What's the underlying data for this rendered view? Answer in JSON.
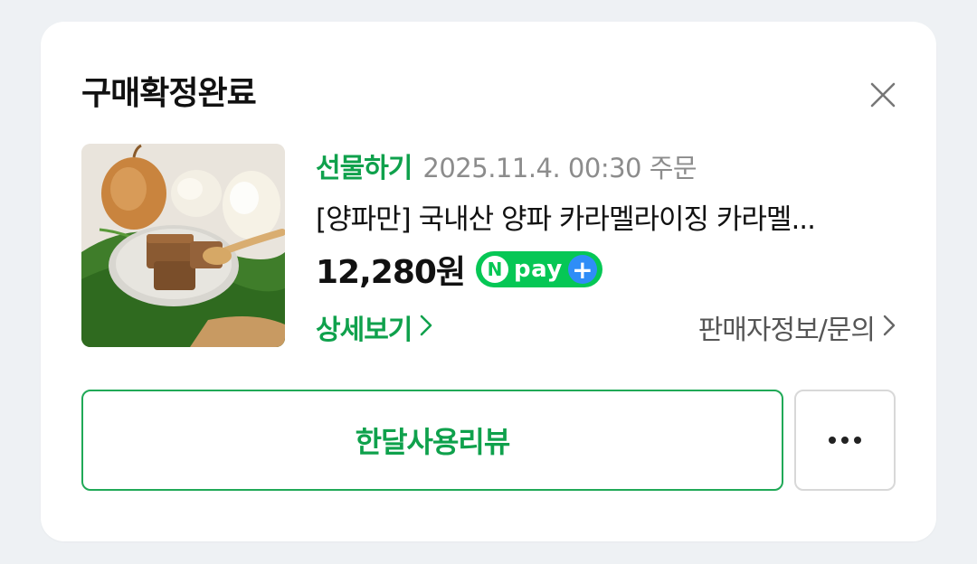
{
  "header": {
    "title": "구매확정완료",
    "close_icon": "close-icon"
  },
  "order": {
    "type_label": "선물하기",
    "order_date": "2025.11.4. 00:30 주문",
    "product_name": "[양파만] 국내산 양파 카라멜라이징 카라멜...",
    "price": "12,280원",
    "pay_badge": {
      "n": "N",
      "word": "pay",
      "plus": "+"
    },
    "detail_link": "상세보기",
    "seller_link": "판매자정보/문의"
  },
  "actions": {
    "review_label": "한달사용리뷰",
    "more_icon": "more-horizontal-icon"
  },
  "colors": {
    "accent_green": "#0fa14c",
    "npay_green": "#06c755",
    "npay_blue": "#2f8df7",
    "background": "#eef1f4"
  }
}
